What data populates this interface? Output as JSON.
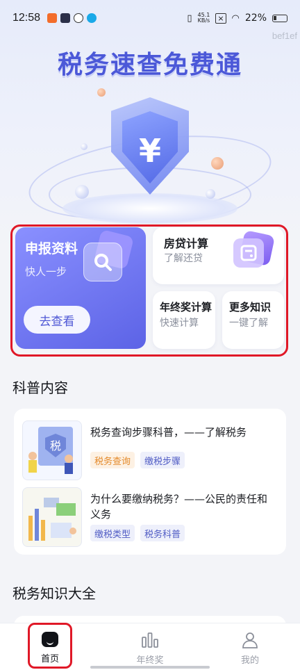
{
  "status_bar": {
    "time": "12:58",
    "network_speed_value": "45.1",
    "network_speed_unit": "KB/s",
    "battery": "22%"
  },
  "hero": {
    "watermark": "bef1ef",
    "title": "税务速查免费通",
    "shield_symbol": "¥"
  },
  "cards": {
    "declaration": {
      "title": "申报资料",
      "subtitle": "快人一步",
      "button": "去查看",
      "icon": "search-icon"
    },
    "mortgage": {
      "title": "房贷计算",
      "subtitle": "了解还贷",
      "icon": "calculator-icon"
    },
    "bonus": {
      "title": "年终奖计算",
      "subtitle": "快速计算"
    },
    "more": {
      "title": "更多知识",
      "subtitle": "一键了解"
    }
  },
  "science_section": {
    "title": "科普内容",
    "articles": [
      {
        "title": "税务查询步骤科普，——了解税务",
        "tags": [
          "税务查询",
          "缴税步骤"
        ]
      },
      {
        "title": "为什么要缴纳税务？——公民的责任和义务",
        "tags": [
          "缴税类型",
          "税务科普"
        ]
      }
    ]
  },
  "knowledge_section": {
    "title": "税务知识大全"
  },
  "tabbar": {
    "items": [
      {
        "label": "首页",
        "icon": "home-icon",
        "active": true
      },
      {
        "label": "年终奖",
        "icon": "bar-chart-icon",
        "active": false
      },
      {
        "label": "我的",
        "icon": "user-icon",
        "active": false
      }
    ]
  },
  "colors": {
    "accent": "#5c63e6",
    "highlight": "#e01827",
    "tag_orange": "#e48a2b",
    "tag_blue": "#4f5bc4"
  }
}
